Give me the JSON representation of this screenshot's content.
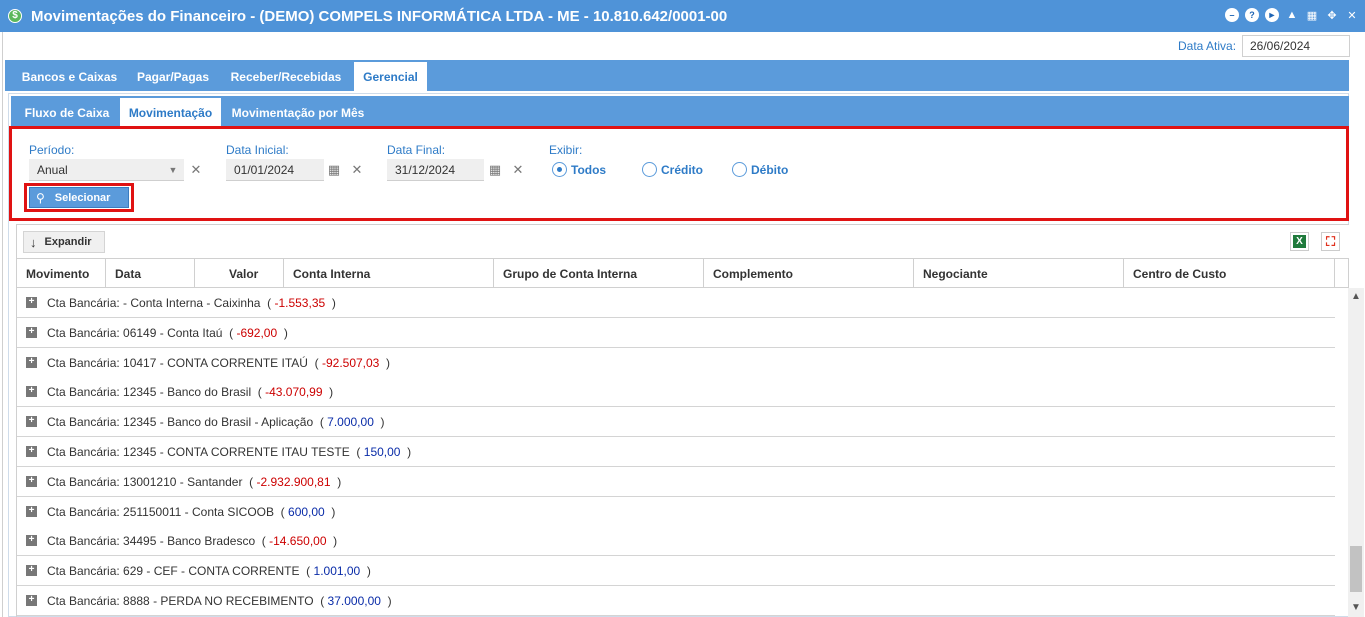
{
  "window": {
    "title": "Movimentações do Financeiro - (DEMO) COMPELS INFORMÁTICA LTDA - ME - 10.810.642/0001-00",
    "icons": [
      "minimize-icon",
      "help-icon",
      "play-icon",
      "bell-icon",
      "calendar-icon",
      "restore-icon",
      "close-icon"
    ]
  },
  "active_date": {
    "label": "Data Ativa:",
    "value": "26/06/2024"
  },
  "tabs_main": [
    "Bancos e Caixas",
    "Pagar/Pagas",
    "Receber/Recebidas",
    "Gerencial"
  ],
  "tabs_main_active": "Gerencial",
  "tabs_sub": [
    "Fluxo de Caixa",
    "Movimentação",
    "Movimentação por Mês"
  ],
  "tabs_sub_active": "Movimentação",
  "filters": {
    "periodo": {
      "label": "Período:",
      "value": "Anual"
    },
    "data_inicial": {
      "label": "Data Inicial:",
      "value": "01/01/2024"
    },
    "data_final": {
      "label": "Data Final:",
      "value": "31/12/2024"
    },
    "exibir": {
      "label": "Exibir:",
      "options": [
        "Todos",
        "Crédito",
        "Débito"
      ],
      "selected": "Todos"
    },
    "select_button": "Selecionar"
  },
  "toolbar": {
    "expand_label": "Expandir",
    "excel_icon": "X"
  },
  "grid": {
    "columns": [
      "Movimento",
      "Data",
      "Valor",
      "Conta Interna",
      "Grupo de Conta Interna",
      "Complemento",
      "Negociante",
      "Centro de Custo"
    ],
    "groups": [
      {
        "prefix": "Cta Bancária: - Conta Interna - Caixinha",
        "amount": "-1.553,35",
        "sign": "neg"
      },
      {
        "prefix": "Cta Bancária: 06149 - Conta Itaú",
        "amount": "-692,00",
        "sign": "neg"
      },
      {
        "prefix": "Cta Bancária: 10417 - CONTA CORRENTE ITAÚ",
        "amount": "-92.507,03",
        "sign": "neg"
      },
      {
        "prefix": "Cta Bancária: 12345 - Banco do Brasil",
        "amount": "-43.070,99",
        "sign": "neg"
      },
      {
        "prefix": "Cta Bancária: 12345 - Banco do Brasil - Aplicação",
        "amount": "7.000,00",
        "sign": "pos"
      },
      {
        "prefix": "Cta Bancária: 12345 - CONTA CORRENTE ITAU TESTE",
        "amount": "150,00",
        "sign": "pos"
      },
      {
        "prefix": "Cta Bancária: 13001210 - Santander",
        "amount": "-2.932.900,81",
        "sign": "neg"
      },
      {
        "prefix": "Cta Bancária: 251150011 - Conta SICOOB",
        "amount": "600,00",
        "sign": "pos"
      },
      {
        "prefix": "Cta Bancária: 34495 - Banco Bradesco",
        "amount": "-14.650,00",
        "sign": "neg"
      },
      {
        "prefix": "Cta Bancária: 629 - CEF - CONTA CORRENTE",
        "amount": "1.001,00",
        "sign": "pos"
      },
      {
        "prefix": "Cta Bancária: 8888 - PERDA NO RECEBIMENTO",
        "amount": "37.000,00",
        "sign": "pos"
      }
    ]
  },
  "colors": {
    "header_blue": "#4f93d8",
    "tab_blue": "#5b9bdb",
    "label_blue": "#2e7bc7",
    "highlight_red": "#e01212",
    "negative": "#cc0000",
    "positive": "#0a2ca8"
  }
}
